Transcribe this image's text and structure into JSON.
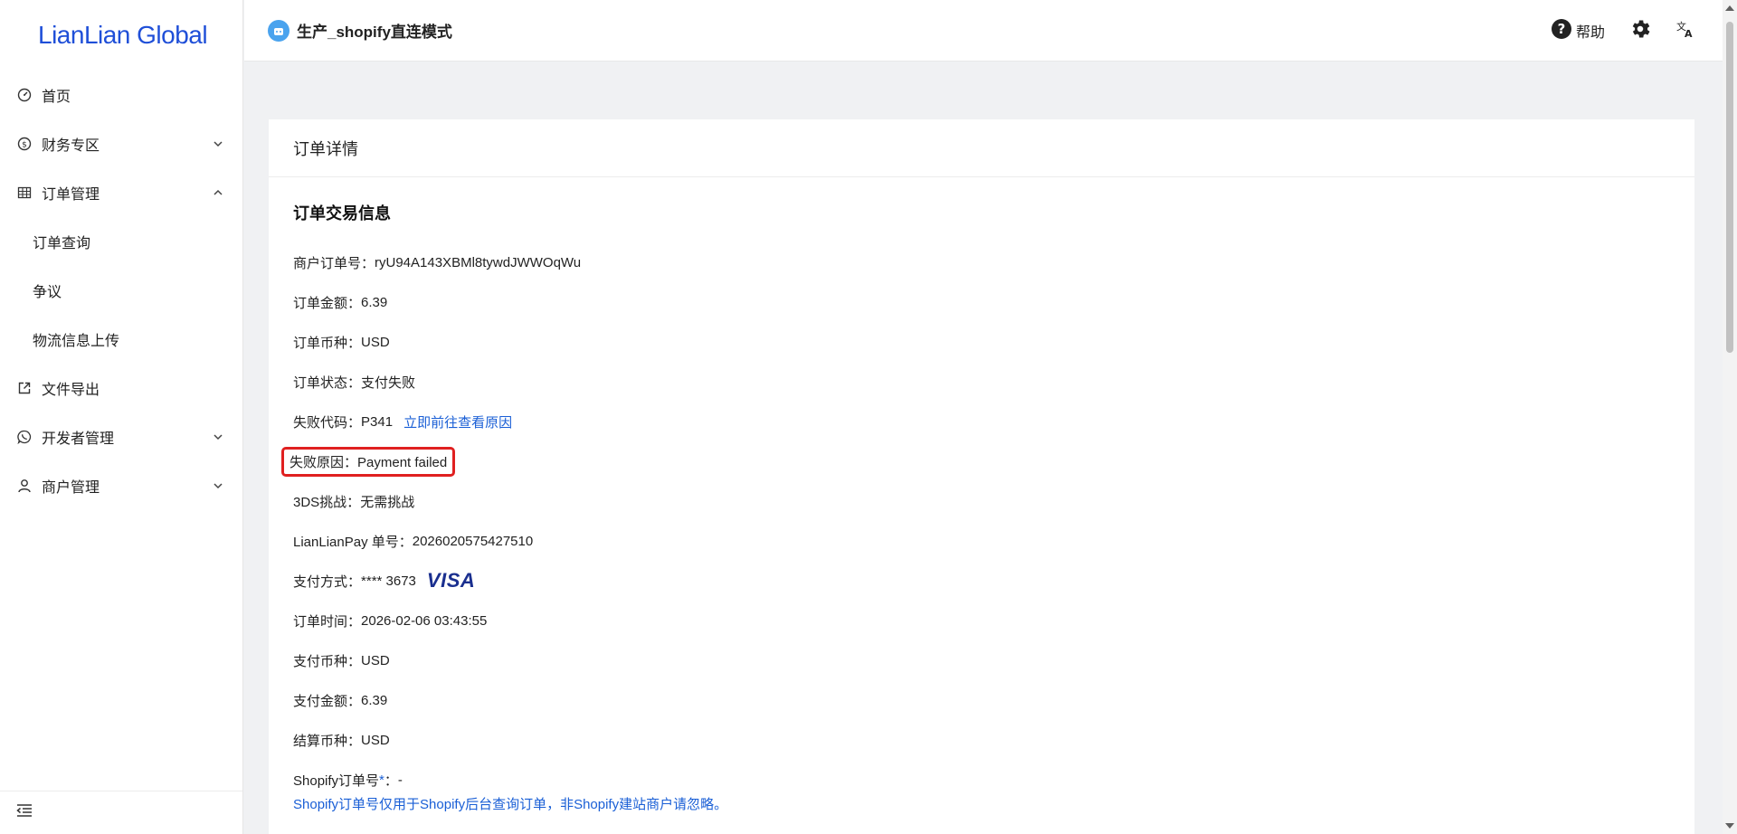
{
  "app": {
    "logo": "LianLian Global"
  },
  "sidebar": {
    "items": [
      {
        "label": "首页",
        "icon": "dashboard-icon"
      },
      {
        "label": "财务专区",
        "icon": "dollar-icon",
        "expanded": false
      },
      {
        "label": "订单管理",
        "icon": "table-icon",
        "expanded": true,
        "children": [
          "订单查询",
          "争议",
          "物流信息上传"
        ]
      },
      {
        "label": "文件导出",
        "icon": "export-icon"
      },
      {
        "label": "开发者管理",
        "icon": "whatsapp-icon",
        "expanded": false
      },
      {
        "label": "商户管理",
        "icon": "user-icon",
        "expanded": false
      }
    ]
  },
  "header": {
    "store_name": "生产_shopify直连模式",
    "help_label": "帮助"
  },
  "card": {
    "title": "订单详情",
    "section_title": "订单交易信息",
    "fields": {
      "merchant_order_no_label": "商户订单号：",
      "merchant_order_no": "ryU94A143XBMl8tywdJWWOqWu",
      "amount_label": "订单金额：",
      "amount": "6.39",
      "currency_label": "订单币种：",
      "currency": "USD",
      "status_label": "订单状态：",
      "status": "支付失败",
      "fail_code_label": "失败代码：",
      "fail_code": "P341",
      "fail_code_link": "立即前往查看原因",
      "fail_reason_label": "失败原因：",
      "fail_reason": "Payment failed",
      "threeds_label": "3DS挑战：",
      "threeds": "无需挑战",
      "llpay_no_label": "LianLianPay 单号：",
      "llpay_no": "2026020575427510",
      "pay_method_label": "支付方式：",
      "pay_method": "**** 3673",
      "card_brand": "VISA",
      "order_time_label": "订单时间：",
      "order_time": "2026-02-06 03:43:55",
      "pay_currency_label": "支付币种：",
      "pay_currency": "USD",
      "pay_amount_label": "支付金额：",
      "pay_amount": "6.39",
      "settle_currency_label": "结算币种：",
      "settle_currency": "USD",
      "shopify_order_label": "Shopify订单号",
      "shopify_order_required": "*",
      "shopify_order_colon": "：",
      "shopify_order_value": "-",
      "shopify_note": "Shopify订单号仅用于Shopify后台查询订单，非Shopify建站商户请忽略。"
    }
  },
  "colors": {
    "brand": "#1f4fd8",
    "link": "#1a5fd6",
    "highlight": "#e02020"
  }
}
